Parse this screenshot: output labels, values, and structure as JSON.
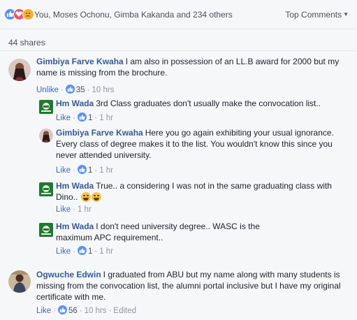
{
  "summary": {
    "reactions_text": "You, Moses Ochonu, Gimba Kakanda and 234 others",
    "sort_label": "Top Comments",
    "shares_text": "44 shares"
  },
  "colors": {
    "link": "#365899",
    "like": "#5890ff",
    "love": "#f25268",
    "sad": "#f7b125"
  },
  "comments": [
    {
      "author": "Gimbiya Farve Kwaha",
      "text": "I am also in possession of an LL.B award for 2000 but my name is missing from the brochure.",
      "action": "Unlike",
      "likes": "35",
      "time": "10 hrs"
    },
    {
      "author": "Hm Wada",
      "text": "3rd Class graduates don't usually make the convocation list..",
      "action": "Like",
      "likes": "1",
      "time": "1 hr"
    },
    {
      "author": "Gimbiya Farve Kwaha",
      "text": "Here you go again exhibiting your usual ignorance. Every class of degree makes it to the list. You wouldn't know this since you never attended university.",
      "action": "Like",
      "likes": "1",
      "time": "1 hr"
    },
    {
      "author": "Hm Wada",
      "text": "True.. a considering I was not in the same graduating class with Dino..",
      "action": "Like",
      "time": "1 hr"
    },
    {
      "author": "Hm Wada",
      "text": "I don't need university degree.. WASC is the maximum APC requirement..",
      "action": "Like",
      "likes": "1",
      "time": "1 hr"
    },
    {
      "author": "Ogwuche Edwin",
      "text": "I graduated from ABU but my name along with many students is missing from the convocation list, the alumni portal inclusive but I have my original certificate with me.",
      "action": "Like",
      "likes": "56",
      "time": "10 hrs",
      "edited": "Edited"
    }
  ]
}
